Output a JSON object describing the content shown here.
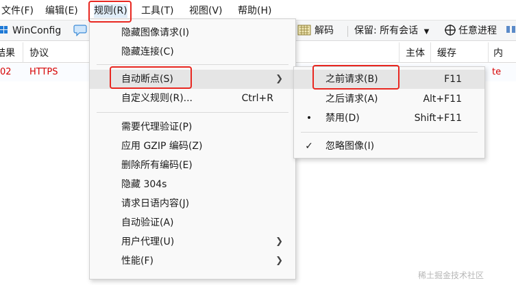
{
  "menubar": {
    "items": [
      "文件(F)",
      "编辑(E)",
      "规则(R)",
      "工具(T)",
      "视图(V)",
      "帮助(H)"
    ]
  },
  "toolbar": {
    "winconfig": "WinConfig",
    "decode": "解码",
    "keep_label": "保留: 所有会话",
    "any_process": "任意进程"
  },
  "list": {
    "headers": [
      "结果",
      "协议",
      "主体",
      "缓存",
      "内"
    ],
    "row": {
      "result": "02",
      "protocol": "HTTPS",
      "extra": "te"
    }
  },
  "rules_menu": {
    "items": [
      {
        "label": "隐藏图像请求(I)"
      },
      {
        "label": "隐藏连接(C)"
      },
      {
        "label": "自动断点(S)",
        "submenu": true
      },
      {
        "label": "自定义规则(R)...",
        "shortcut": "Ctrl+R"
      },
      {
        "label": "需要代理验证(P)"
      },
      {
        "label": "应用 GZIP 编码(Z)"
      },
      {
        "label": "删除所有编码(E)"
      },
      {
        "label": "隐藏 304s"
      },
      {
        "label": "请求日语内容(J)"
      },
      {
        "label": "自动验证(A)"
      },
      {
        "label": "用户代理(U)",
        "submenu": true
      },
      {
        "label": "性能(F)",
        "submenu": true
      }
    ]
  },
  "breakpoint_submenu": {
    "items": [
      {
        "label": "之前请求(B)",
        "shortcut": "F11"
      },
      {
        "label": "之后请求(A)",
        "shortcut": "Alt+F11"
      },
      {
        "label": "禁用(D)",
        "shortcut": "Shift+F11",
        "checked_mark": "•"
      },
      {
        "label": "忽略图像(I)",
        "checked_mark": "✓"
      }
    ]
  },
  "watermark": "稀土掘金技术社区",
  "colors": {
    "annotation": "#e8261f",
    "https_text": "#d60000",
    "highlight": "#e5e5e5"
  }
}
